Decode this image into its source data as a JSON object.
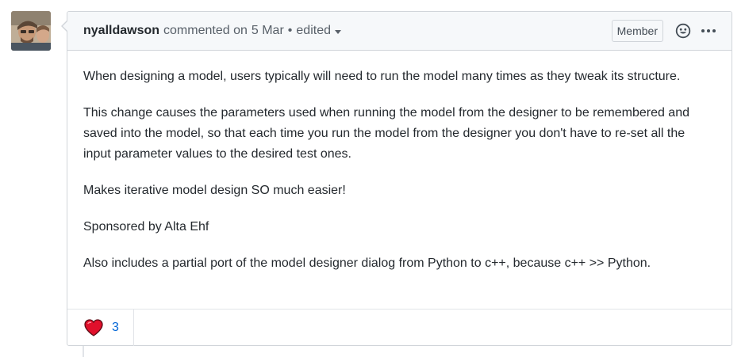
{
  "comment": {
    "author": "nyalldawson",
    "action": "commented on",
    "date": "5 Mar",
    "separator": "•",
    "edited_label": "edited",
    "role_badge": "Member",
    "paragraphs": [
      "When designing a model, users typically will need to run the model many times as they tweak its structure.",
      "This change causes the parameters used when running the model from the designer to be remembered and saved into the model, so that each time you run the model from the designer you don't have to re-set all the input parameter values to the desired test ones.",
      "Makes iterative model design SO much easier!",
      "Sponsored by Alta Ehf",
      "Also includes a partial port of the model designer dialog from Python to c++, because c++ >> Python."
    ],
    "reactions": [
      {
        "icon": "heart-icon",
        "count": "3"
      }
    ]
  },
  "icons": {
    "emoji": "smiley-icon",
    "more": "kebab-horizontal-icon",
    "reaction": "heart-icon"
  },
  "colors": {
    "link_blue": "#0366d6",
    "heart_red": "#e0102b",
    "header_bg": "#f6f8fa",
    "border": "#d1d5da"
  }
}
